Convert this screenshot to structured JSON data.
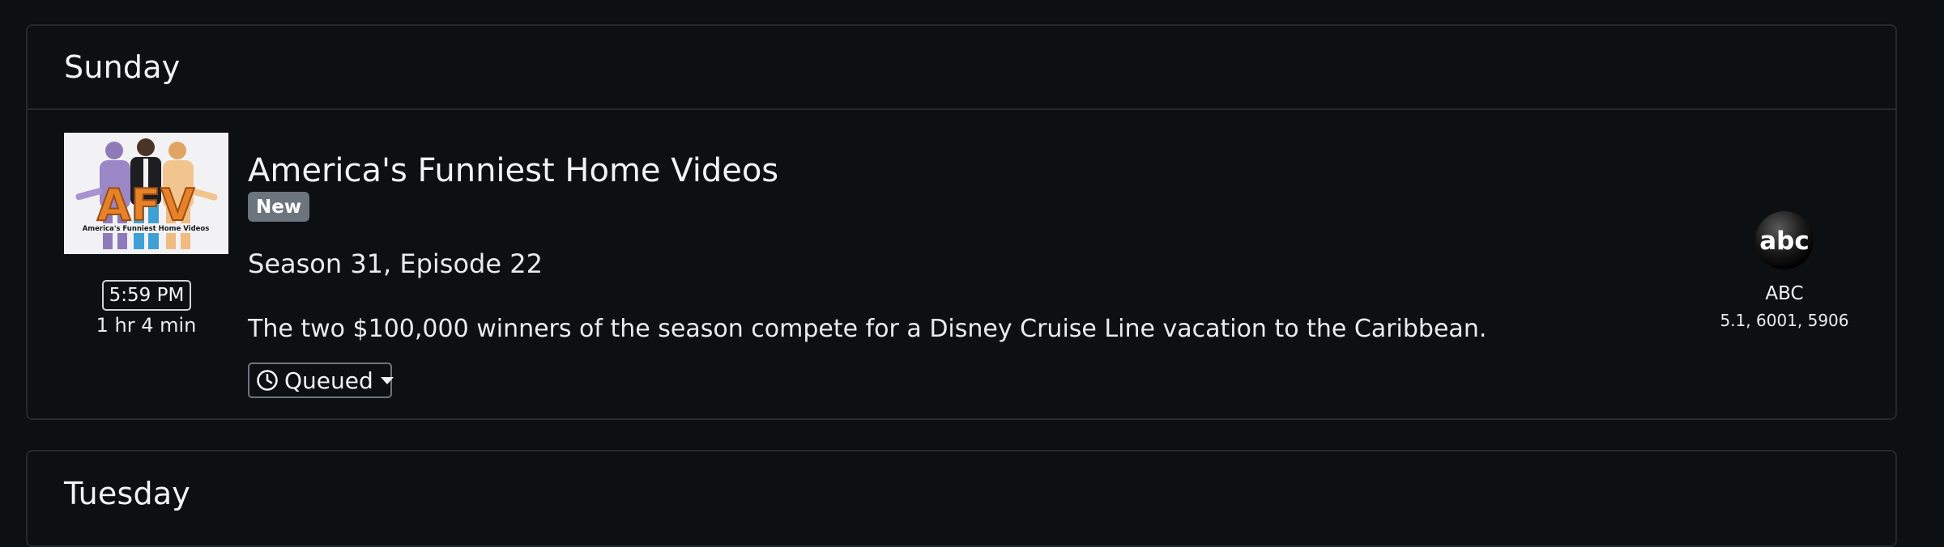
{
  "sections": [
    {
      "day": "Sunday",
      "program": {
        "title": "America's Funniest Home Videos",
        "badge": "New",
        "episode": "Season 31, Episode 22",
        "description": "The two $100,000 winners of the season compete for a Disney Cruise Line vacation to the Caribbean.",
        "start_time": "5:59 PM",
        "duration": "1 hr 4 min",
        "status": "Queued",
        "status_icon": "clock-icon",
        "thumbnail_text": "AFV",
        "thumbnail_caption": "America's Funniest Home Videos",
        "network": {
          "name": "ABC",
          "logo_text": "abc",
          "channels": "5.1, 6001, 5906"
        }
      }
    },
    {
      "day": "Tuesday"
    }
  ],
  "colors": {
    "background": "#0c1012",
    "border": "#23292e",
    "badge": "#6c757d",
    "text": "#e8ecef"
  }
}
